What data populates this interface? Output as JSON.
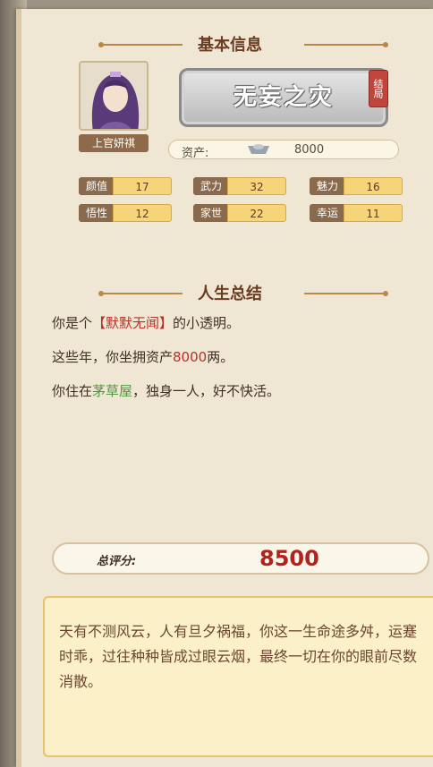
{
  "sections": {
    "basic_info_title": "基本信息",
    "life_summary_title": "人生总结"
  },
  "character": {
    "name": "上官妍祺",
    "ending_title": "无妄之灾",
    "ending_badge": "结局",
    "assets_label": "资产:",
    "assets_value": "8000"
  },
  "stats": [
    {
      "label": "颜值",
      "value": "17"
    },
    {
      "label": "武力",
      "value": "32"
    },
    {
      "label": "魅力",
      "value": "16"
    },
    {
      "label": "悟性",
      "value": "12"
    },
    {
      "label": "家世",
      "value": "22"
    },
    {
      "label": "幸运",
      "value": "11"
    }
  ],
  "summary": {
    "line1_prefix": "你是个",
    "line1_highlight": "【默默无闻】",
    "line1_suffix": "的小透明。",
    "line2_prefix": "这些年，你坐拥资产",
    "line2_highlight": "8000",
    "line2_suffix": "两。",
    "line3_prefix": "你住在",
    "line3_highlight": "茅草屋",
    "line3_suffix": "，独身一人，好不快活。"
  },
  "score": {
    "label": "总评分:",
    "value": "8500"
  },
  "verdict_text": "天有不测风云，人有旦夕祸福，你这一生命途多舛，运蹇时乖，过往种种皆成过眼云烟，最终一切在你的眼前尽数消散。",
  "colors": {
    "accent_red": "#b4322a",
    "accent_green": "#4b9a3b",
    "score_red": "#b3221d"
  }
}
